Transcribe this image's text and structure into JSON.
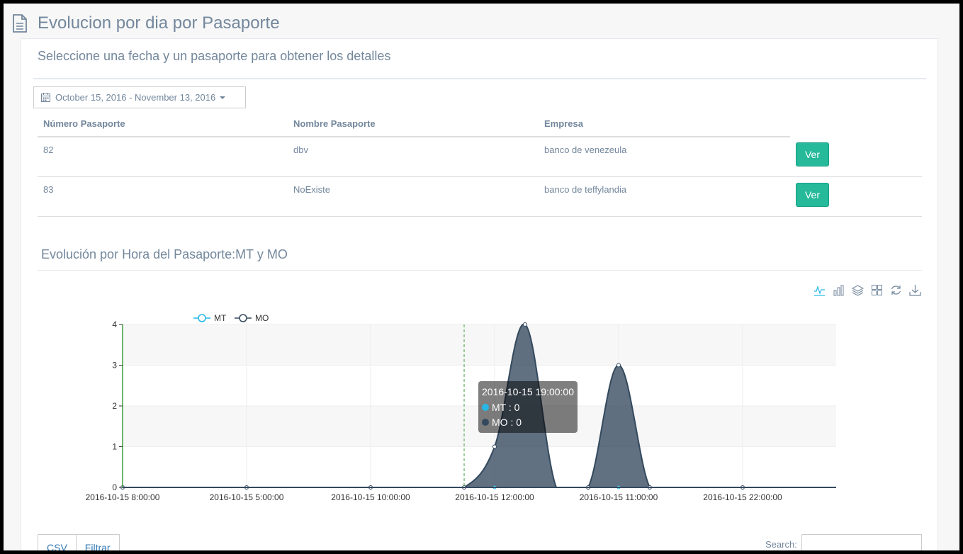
{
  "page_title": "Evolucion por dia por Pasaporte",
  "panel": {
    "title": "Seleccione una fecha y un pasaporte para obtener los detalles",
    "date_range": "October 15, 2016 - November 13, 2016"
  },
  "table": {
    "headers": [
      "Número Pasaporte",
      "Nombre Pasaporte",
      "Empresa"
    ],
    "rows": [
      {
        "numero": "82",
        "nombre": "dbv",
        "empresa": "banco de venezeula",
        "action": "Ver"
      },
      {
        "numero": "83",
        "nombre": "NoExiste",
        "empresa": "banco de teffylandia",
        "action": "Ver"
      }
    ]
  },
  "chart_section": {
    "title": "Evolución por Hora del Pasaporte:MT y MO"
  },
  "toolbox_icons": [
    "line-chart-icon",
    "bar-chart-icon",
    "stack-icon",
    "tiled-icon",
    "refresh-icon",
    "download-icon"
  ],
  "colors": {
    "mt": "#26b7e6",
    "mo": "#34495e",
    "accent": "#26b99a"
  },
  "chart_data": {
    "type": "area",
    "x": [
      "2016-10-15 8:00:00",
      "",
      "2016-10-15 5:00:00",
      "",
      "2016-10-15 10:00:00",
      "",
      "2016-10-15 12:00:00",
      "2016-10-15 19:00:00",
      "",
      "",
      "",
      "2016-10-15 11:00:00",
      "",
      "",
      "2016-10-15 22:00:00",
      ""
    ],
    "xticks": [
      "2016-10-15 8:00:00",
      "2016-10-15 5:00:00",
      "2016-10-15 10:00:00",
      "2016-10-15 12:00:00",
      "2016-10-15 11:00:00",
      "2016-10-15 22:00:00"
    ],
    "series": [
      {
        "name": "MT",
        "values": [
          0,
          0,
          0,
          0,
          0,
          0,
          0,
          0,
          0,
          0,
          0,
          0,
          0,
          0,
          0,
          0
        ]
      },
      {
        "name": "MO",
        "values": [
          0,
          0,
          0,
          0,
          0,
          0,
          0,
          1,
          4,
          0,
          0,
          3,
          0,
          0,
          0,
          0
        ]
      }
    ],
    "ylim": [
      0,
      4
    ],
    "yticks": [
      0,
      1,
      2,
      3,
      4
    ],
    "legend": "top-left",
    "grid": true,
    "tooltip": {
      "title": "2016-10-15 19:00:00",
      "items": [
        "MT : 0",
        "MO : 0"
      ]
    }
  },
  "footer": {
    "csv_label": "CSV",
    "filter_label": "Filtrar",
    "search_label": "Search:"
  }
}
